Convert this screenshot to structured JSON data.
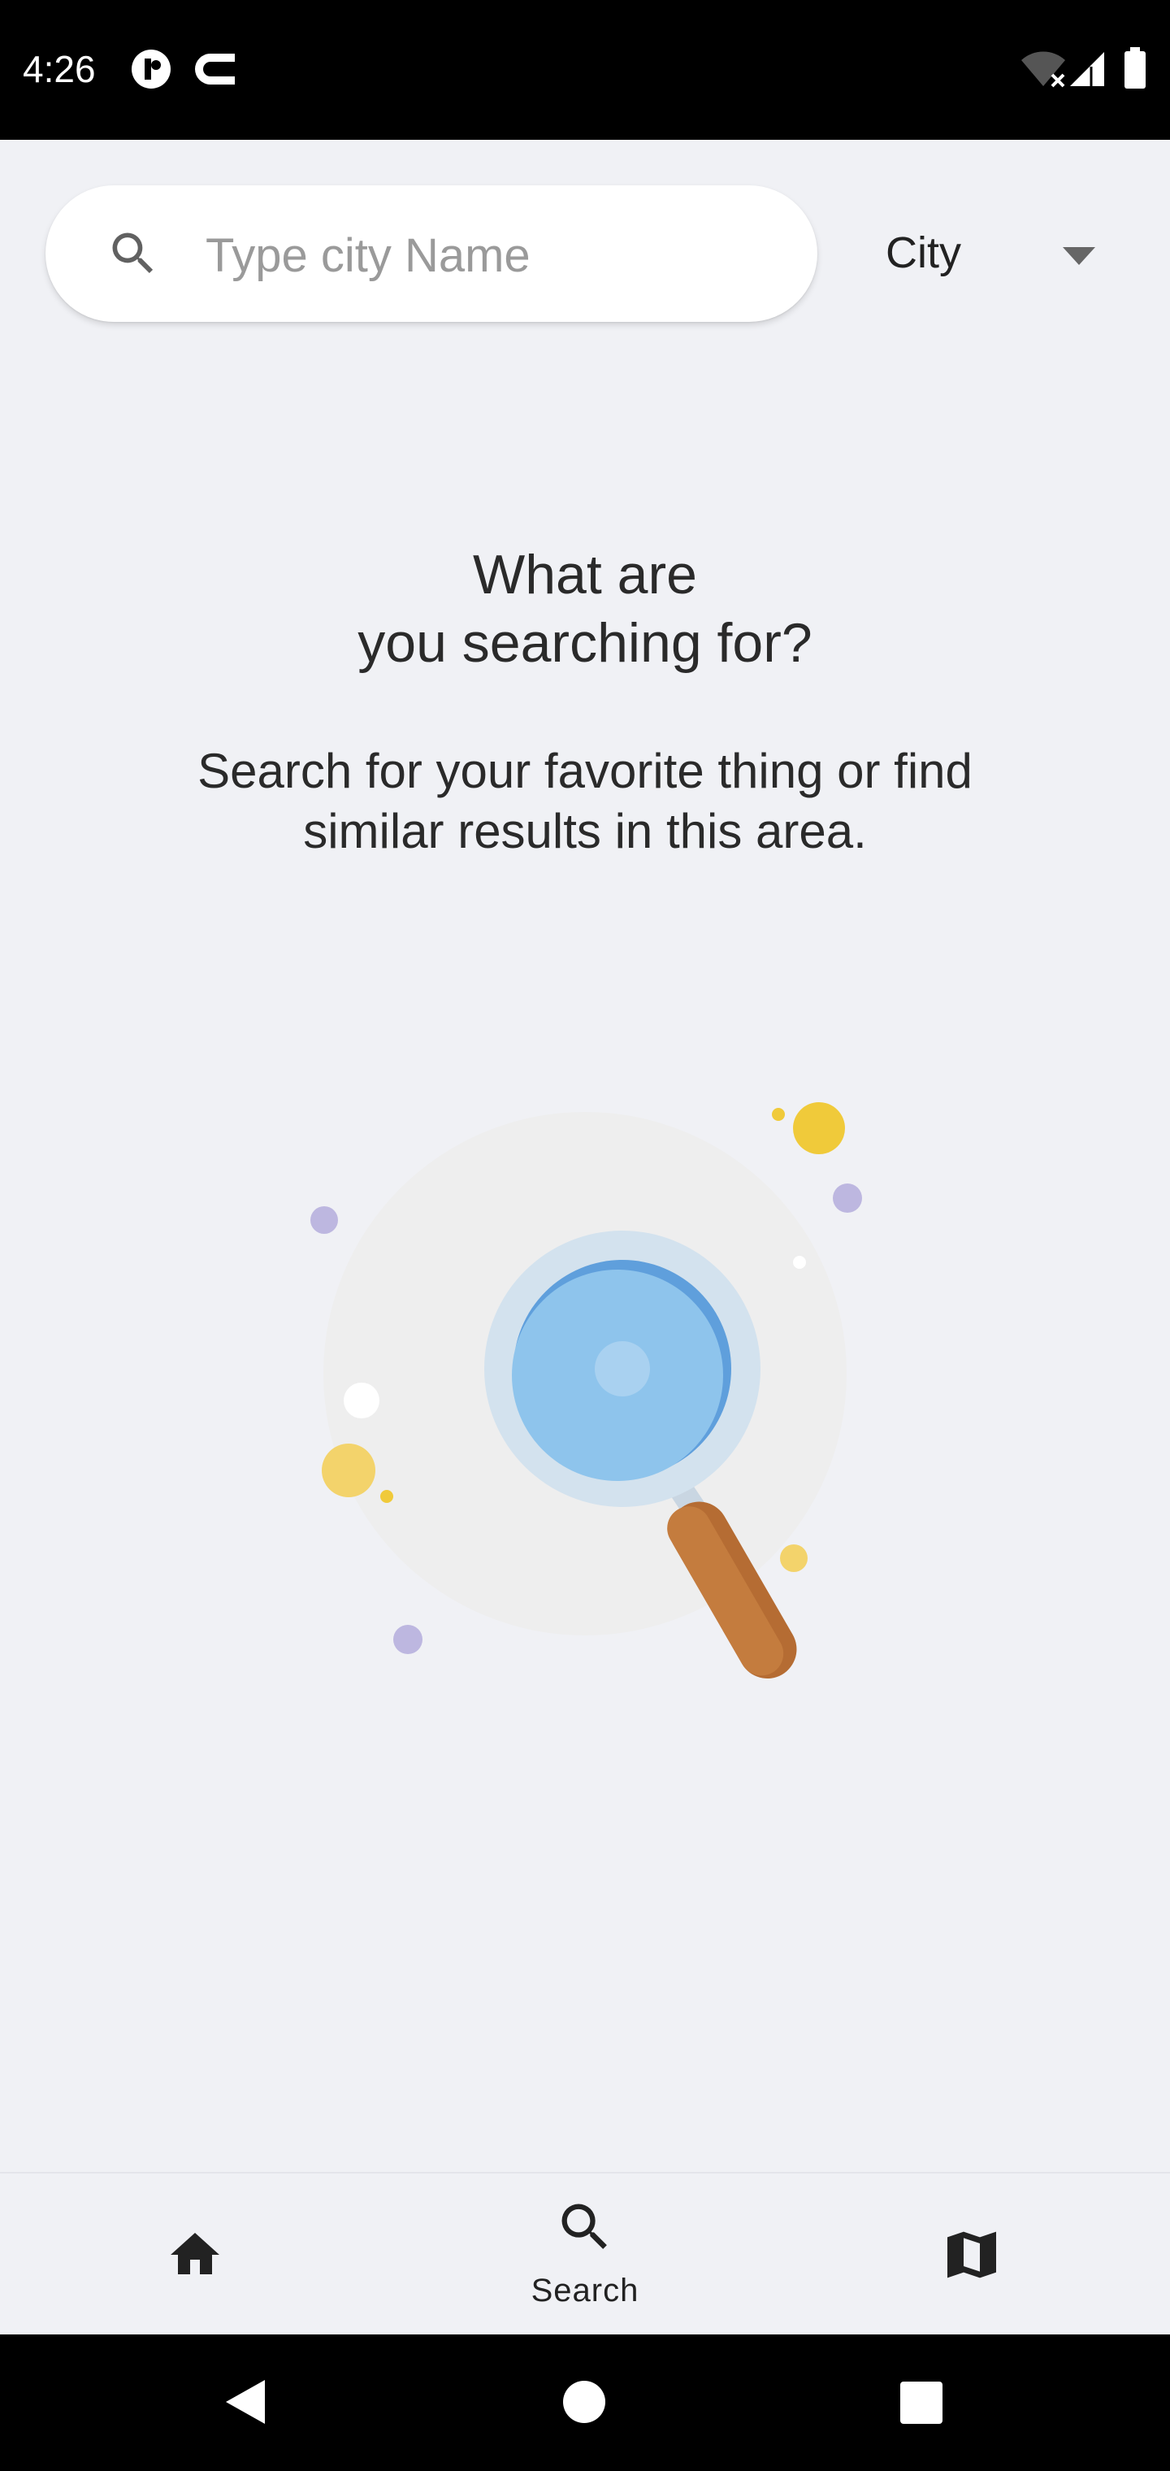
{
  "status_bar": {
    "time": "4:26",
    "left_icons": [
      "notification-app-icon",
      "cast-app-icon"
    ],
    "right_icons": [
      "wifi-off-icon",
      "signal-icon",
      "battery-icon"
    ]
  },
  "search": {
    "placeholder": "Type city Name",
    "value": "",
    "icon": "search-icon"
  },
  "filter": {
    "selected": "City",
    "icon": "caret-down-icon"
  },
  "empty_state": {
    "title_line1": "What are",
    "title_line2": "you searching for?",
    "subtitle_line1": "Search for your favorite thing or find",
    "subtitle_line2": "similar results in this area.",
    "illustration": "magnifying-glass-illustration",
    "colors": {
      "lens": "#8ec4ec",
      "lens_rim": "#d3e2ee",
      "handle": "#c47c3e",
      "dot_yellow": "#f0ca3a",
      "dot_purple": "#bdb7e0"
    }
  },
  "bottom_nav": {
    "items": [
      {
        "icon": "home-icon",
        "label": ""
      },
      {
        "icon": "search-icon",
        "label": "Search"
      },
      {
        "icon": "map-icon",
        "label": ""
      }
    ]
  },
  "system_nav": {
    "buttons": [
      "back-icon",
      "home-circle-icon",
      "recents-icon"
    ]
  }
}
